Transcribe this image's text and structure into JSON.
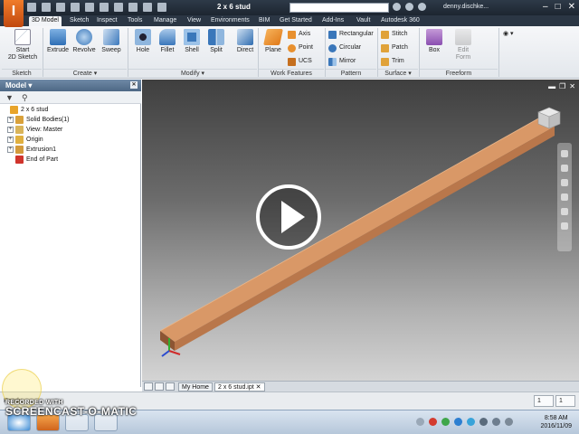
{
  "window": {
    "title": "2 x 6 stud",
    "app_letter": "I",
    "user": "denny.dischke...",
    "search_placeholder": ""
  },
  "ribbon_tabs": [
    "3D Model",
    "Sketch",
    "Inspect",
    "Tools",
    "Manage",
    "View",
    "Environments",
    "BIM",
    "Get Started",
    "Add-Ins",
    "Vault",
    "Autodesk 360"
  ],
  "ribbon": {
    "sketch": {
      "start_line1": "Start",
      "start_line2": "2D Sketch",
      "panel": "Sketch"
    },
    "create": {
      "extrude": "Extrude",
      "revolve": "Revolve",
      "sweep": "Sweep",
      "panel": "Create ▾"
    },
    "modify": {
      "hole": "Hole",
      "fillet": "Fillet",
      "shell": "Shell",
      "split": "Split",
      "direct": "Direct",
      "panel": "Modify ▾"
    },
    "work_features": {
      "plane": "Plane",
      "axis": "Axis",
      "point": "Point",
      "ucs": "UCS",
      "panel": "Work Features"
    },
    "pattern": {
      "rectangular": "Rectangular",
      "circular": "Circular",
      "mirror": "Mirror",
      "panel": "Pattern"
    },
    "surface": {
      "stitch": "Stitch",
      "patch": "Patch",
      "trim": "Trim",
      "panel": "Surface ▾"
    },
    "freeform": {
      "box": "Box",
      "edit_form_line1": "Edit",
      "edit_form_line2": "Form",
      "panel": "Freeform"
    }
  },
  "browser": {
    "title": "Model ▾",
    "tree": [
      {
        "label": "2 x 6 stud",
        "level": 0,
        "expander": "",
        "icon_color": "#e8a42a"
      },
      {
        "label": "Solid Bodies(1)",
        "level": 1,
        "expander": "+",
        "icon_color": "#d9a13a"
      },
      {
        "label": "View: Master",
        "level": 1,
        "expander": "+",
        "icon_color": "#d9b45a"
      },
      {
        "label": "Origin",
        "level": 1,
        "expander": "+",
        "icon_color": "#e0b040"
      },
      {
        "label": "Extrusion1",
        "level": 1,
        "expander": "+",
        "icon_color": "#d39a3b"
      },
      {
        "label": "End of Part",
        "level": 1,
        "expander": "",
        "icon_color": "#d0342c"
      }
    ]
  },
  "doc_tabs": {
    "home": "My Home",
    "active": "2 x 6 stud.ipt"
  },
  "status": {
    "ready": "Ready",
    "count1": "1",
    "count2": "1"
  },
  "taskbar": {
    "time": "8:58 AM",
    "date": "2016/11/09"
  },
  "watermark": {
    "line1": "RECORDED WITH",
    "line2": "SCREENCAST-O-MATIC"
  }
}
